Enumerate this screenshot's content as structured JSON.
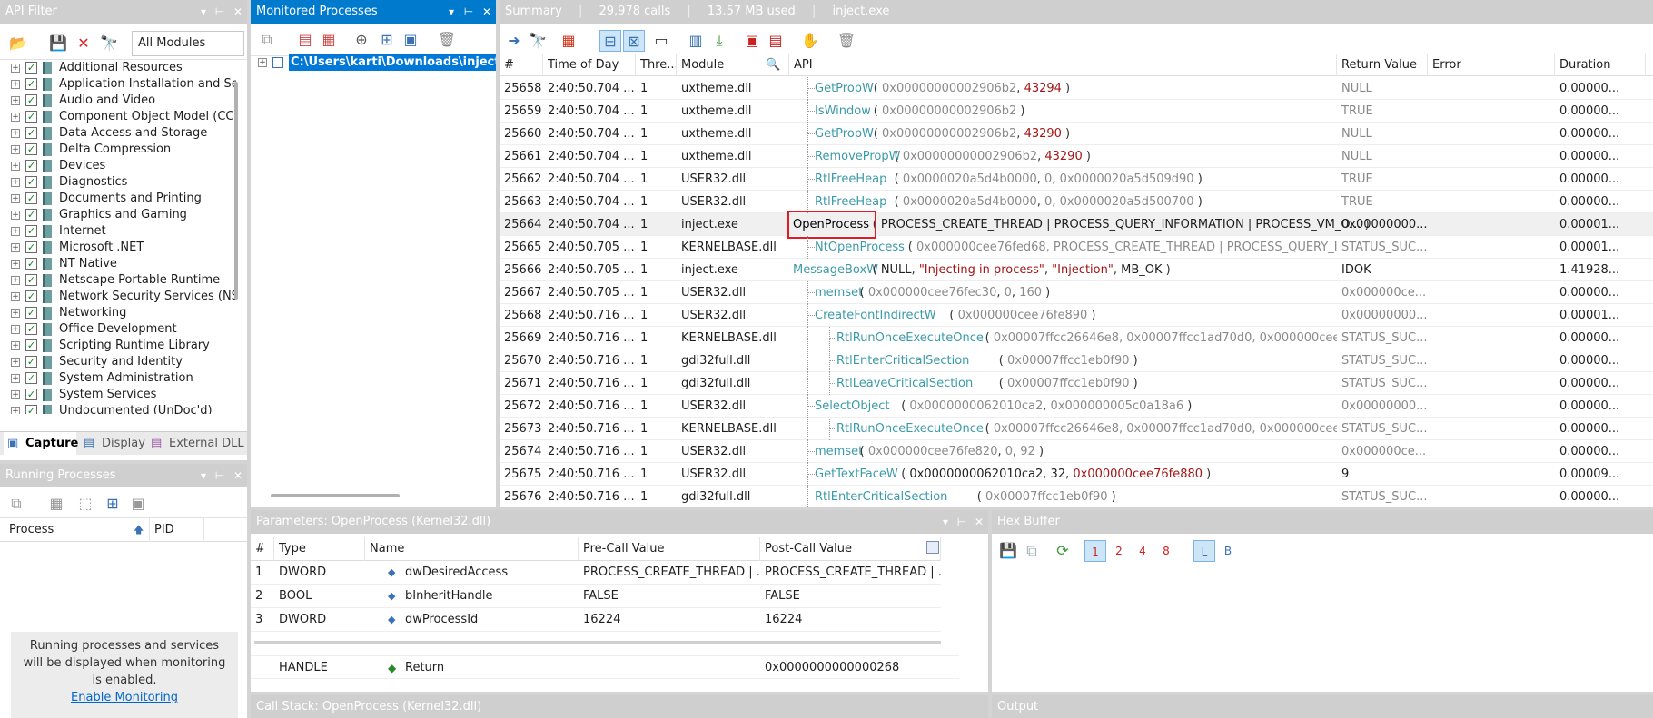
{
  "api_filter": {
    "title": "API Filter",
    "module_select": "All Modules",
    "categories": [
      "Additional Resources",
      "Application Installation and Se",
      "Audio and Video",
      "Component Object Model (CC",
      "Data Access and Storage",
      "Delta Compression",
      "Devices",
      "Diagnostics",
      "Documents and Printing",
      "Graphics and Gaming",
      "Internet",
      "Microsoft .NET",
      "NT Native",
      "Netscape Portable Runtime",
      "Network Security Services (NSS",
      "Networking",
      "Office Development",
      "Scripting Runtime Library",
      "Security and Identity",
      "System Administration",
      "System Services",
      "Undocumented (UnDoc'd)"
    ],
    "tabs": [
      "Capture",
      "Display",
      "External DLL"
    ]
  },
  "running_processes": {
    "title": "Running Processes",
    "col_process": "Process",
    "col_pid": "PID",
    "message": "Running processes and services will be displayed when monitoring is enabled.",
    "link": "Enable Monitoring"
  },
  "monitored": {
    "title": "Monitored Processes",
    "item": "C:\\Users\\karti\\Downloads\\inject.e"
  },
  "summary": {
    "title": "Summary",
    "calls": "29,978 calls",
    "memory": "13.57 MB used",
    "process": "inject.exe"
  },
  "calls_table": {
    "columns": [
      "#",
      "Time of Day",
      "Thre...",
      "Module",
      "API",
      "Return Value",
      "Error",
      "Duration"
    ],
    "rows": [
      {
        "n": "25658",
        "t": "2:40:50.704 ...",
        "th": "1",
        "mod": "uxtheme.dll",
        "lvl": 1,
        "fn": "GetPropW",
        "args": [
          [
            "0x00000000002906b2",
            "g"
          ],
          [
            "43294",
            "r"
          ]
        ],
        "ret": "NULL",
        "err": "",
        "dur": "0.00000..."
      },
      {
        "n": "25659",
        "t": "2:40:50.704 ...",
        "th": "1",
        "mod": "uxtheme.dll",
        "lvl": 1,
        "fn": "IsWindow",
        "args": [
          [
            "0x00000000002906b2",
            "g"
          ]
        ],
        "ret": "TRUE",
        "err": "",
        "dur": "0.00000..."
      },
      {
        "n": "25660",
        "t": "2:40:50.704 ...",
        "th": "1",
        "mod": "uxtheme.dll",
        "lvl": 1,
        "fn": "GetPropW",
        "args": [
          [
            "0x00000000002906b2",
            "g"
          ],
          [
            "43290",
            "r"
          ]
        ],
        "ret": "NULL",
        "err": "",
        "dur": "0.00000..."
      },
      {
        "n": "25661",
        "t": "2:40:50.704 ...",
        "th": "1",
        "mod": "uxtheme.dll",
        "lvl": 1,
        "fn": "RemovePropW",
        "args": [
          [
            "0x00000000002906b2",
            "g"
          ],
          [
            "43290",
            "r"
          ]
        ],
        "ret": "NULL",
        "err": "",
        "dur": "0.00000..."
      },
      {
        "n": "25662",
        "t": "2:40:50.704 ...",
        "th": "1",
        "mod": "USER32.dll",
        "lvl": 1,
        "fn": "RtlFreeHeap",
        "args": [
          [
            "0x0000020a5d4b0000",
            "g"
          ],
          [
            "0",
            "g"
          ],
          [
            "0x0000020a5d509d90",
            "g"
          ]
        ],
        "ret": "TRUE",
        "err": "",
        "dur": "0.00000..."
      },
      {
        "n": "25663",
        "t": "2:40:50.704 ...",
        "th": "1",
        "mod": "USER32.dll",
        "lvl": 1,
        "fn": "RtlFreeHeap",
        "args": [
          [
            "0x0000020a5d4b0000",
            "g"
          ],
          [
            "0",
            "g"
          ],
          [
            "0x0000020a5d500700",
            "g"
          ]
        ],
        "ret": "TRUE",
        "err": "",
        "dur": "0.00000..."
      },
      {
        "n": "25664",
        "t": "2:40:50.704 ...",
        "th": "1",
        "mod": "inject.exe",
        "lvl": 0,
        "fn": "OpenProcess",
        "args": [
          [
            "PROCESS_CREATE_THREAD | PROCESS_QUERY_INFORMATION | PROCESS_VM_O...",
            "k"
          ]
        ],
        "ret": "0x00000000...",
        "err": "",
        "dur": "0.00001...",
        "sel": true
      },
      {
        "n": "25665",
        "t": "2:40:50.705 ...",
        "th": "1",
        "mod": "KERNELBASE.dll",
        "lvl": 1,
        "fn": "NtOpenProcess",
        "args": [
          [
            "0x000000cee76fed68, PROCESS_CREATE_THREAD | PROCESS_QUERY_INF...",
            "g"
          ]
        ],
        "ret": "STATUS_SUC...",
        "err": "",
        "dur": "0.00001..."
      },
      {
        "n": "25666",
        "t": "2:40:50.705 ...",
        "th": "1",
        "mod": "inject.exe",
        "lvl": 0,
        "fn": "MessageBoxW",
        "args": [
          [
            "NULL",
            "k"
          ],
          [
            "\"Injecting in process\"",
            "r"
          ],
          [
            "\"Injection\"",
            "r"
          ],
          [
            "MB_OK",
            "k"
          ]
        ],
        "ret": "IDOK",
        "err": "",
        "dur": "1.41928..."
      },
      {
        "n": "25667",
        "t": "2:40:50.705 ...",
        "th": "1",
        "mod": "USER32.dll",
        "lvl": 1,
        "fn": "memset",
        "args": [
          [
            "0x000000cee76fec30",
            "g"
          ],
          [
            "0",
            "g"
          ],
          [
            "160",
            "g"
          ]
        ],
        "ret": "0x000000ce...",
        "err": "",
        "dur": "0.00000..."
      },
      {
        "n": "25668",
        "t": "2:40:50.716 ...",
        "th": "1",
        "mod": "USER32.dll",
        "lvl": 1,
        "fn": "CreateFontIndirectW",
        "args": [
          [
            "0x000000cee76fe890",
            "g"
          ]
        ],
        "ret": "0x00000000...",
        "err": "",
        "dur": "0.00001..."
      },
      {
        "n": "25669",
        "t": "2:40:50.716 ...",
        "th": "1",
        "mod": "KERNELBASE.dll",
        "lvl": 2,
        "fn": "RtlRunOnceExecuteOnce",
        "args": [
          [
            "0x00007ffcc26646e8, 0x00007ffcc1ad70d0, 0x000000cee76fe...",
            "g"
          ]
        ],
        "ret": "STATUS_SUC...",
        "err": "",
        "dur": "0.00000..."
      },
      {
        "n": "25670",
        "t": "2:40:50.716 ...",
        "th": "1",
        "mod": "gdi32full.dll",
        "lvl": 2,
        "fn": "RtlEnterCriticalSection",
        "args": [
          [
            "0x00007ffcc1eb0f90",
            "g"
          ]
        ],
        "ret": "STATUS_SUC...",
        "err": "",
        "dur": "0.00000..."
      },
      {
        "n": "25671",
        "t": "2:40:50.716 ...",
        "th": "1",
        "mod": "gdi32full.dll",
        "lvl": 2,
        "fn": "RtlLeaveCriticalSection",
        "args": [
          [
            "0x00007ffcc1eb0f90",
            "g"
          ]
        ],
        "ret": "STATUS_SUC...",
        "err": "",
        "dur": "0.00000..."
      },
      {
        "n": "25672",
        "t": "2:40:50.716 ...",
        "th": "1",
        "mod": "USER32.dll",
        "lvl": 1,
        "fn": "SelectObject",
        "args": [
          [
            "0x0000000062010ca2",
            "g"
          ],
          [
            "0x000000005c0a18a6",
            "g"
          ]
        ],
        "ret": "0x00000000...",
        "err": "",
        "dur": "0.00000..."
      },
      {
        "n": "25673",
        "t": "2:40:50.716 ...",
        "th": "1",
        "mod": "KERNELBASE.dll",
        "lvl": 2,
        "fn": "RtlRunOnceExecuteOnce",
        "args": [
          [
            "0x00007ffcc26646e8, 0x00007ffcc1ad70d0, 0x000000cee76fe...",
            "g"
          ]
        ],
        "ret": "STATUS_SUC...",
        "err": "",
        "dur": "0.00000..."
      },
      {
        "n": "25674",
        "t": "2:40:50.716 ...",
        "th": "1",
        "mod": "USER32.dll",
        "lvl": 1,
        "fn": "memset",
        "args": [
          [
            "0x000000cee76fe820",
            "g"
          ],
          [
            "0",
            "g"
          ],
          [
            "92",
            "g"
          ]
        ],
        "ret": "0x000000ce...",
        "err": "",
        "dur": "0.00000..."
      },
      {
        "n": "25675",
        "t": "2:40:50.716 ...",
        "th": "1",
        "mod": "USER32.dll",
        "lvl": 1,
        "fn": "GetTextFaceW",
        "args": [
          [
            "0x0000000062010ca2",
            "k"
          ],
          [
            "32",
            "k"
          ],
          [
            "0x000000cee76fe880",
            "r"
          ]
        ],
        "ret": "9",
        "err": "",
        "dur": "0.00009..."
      },
      {
        "n": "25676",
        "t": "2:40:50.716 ...",
        "th": "1",
        "mod": "gdi32full.dll",
        "lvl": 1,
        "fn": "RtlEnterCriticalSection",
        "args": [
          [
            "0x00007ffcc1eb0f90",
            "g"
          ]
        ],
        "ret": "STATUS_SUC...",
        "err": "",
        "dur": "0.00000..."
      }
    ]
  },
  "parameters": {
    "title": "Parameters: OpenProcess (Kernel32.dll)",
    "columns": [
      "#",
      "Type",
      "Name",
      "Pre-Call Value",
      "Post-Call Value"
    ],
    "rows": [
      {
        "n": "1",
        "type": "DWORD",
        "name": "dwDesiredAccess",
        "pre": "PROCESS_CREATE_THREAD | ...",
        "post": "PROCESS_CREATE_THREAD | ..."
      },
      {
        "n": "2",
        "type": "BOOL",
        "name": "bInheritHandle",
        "pre": "FALSE",
        "post": "FALSE"
      },
      {
        "n": "3",
        "type": "DWORD",
        "name": "dwProcessId",
        "pre": "16224",
        "post": "16224"
      }
    ],
    "return": {
      "type": "HANDLE",
      "name": "Return",
      "post": "0x0000000000000268"
    }
  },
  "hex": {
    "title": "Hex Buffer",
    "buttons": [
      "1",
      "2",
      "4",
      "8",
      "L",
      "B"
    ]
  },
  "callstack": {
    "title": "Call Stack: OpenProcess (Kernel32.dll)"
  },
  "output": {
    "title": "Output"
  },
  "colors": {
    "accent": "#007acc",
    "function": "#3b9aa8",
    "string": "#a31515",
    "highlight_box": "#e01b24"
  }
}
